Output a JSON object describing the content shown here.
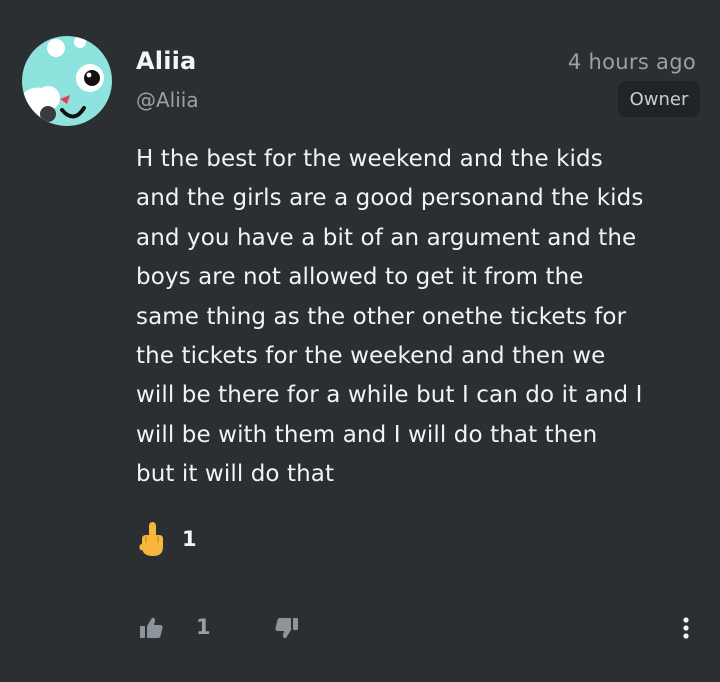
{
  "comment": {
    "author": {
      "name": "Aliia",
      "handle": "@Aliia",
      "badge": "Owner",
      "avatar_icon": "cartoon-face-avatar"
    },
    "timestamp": "4 hours ago",
    "body": "H the best for the weekend and the kids\nand the girls are a good personand the kids\nand you have a bit of an argument and the\nboys are not allowed to get it from the\nsame thing as the other onethe tickets for\nthe tickets for the weekend and then we\nwill be there for a while but I can do it and I\nwill be with them and I will do that then\nbut it will do that",
    "reaction": {
      "emoji_icon": "middle-finger-emoji",
      "count": "1"
    },
    "actions": {
      "like_icon": "thumbs-up-icon",
      "like_count": "1",
      "dislike_icon": "thumbs-down-icon",
      "more_icon": "more-vertical-icon"
    }
  },
  "colors": {
    "background": "#2b2f31",
    "text": "#f2f3f4",
    "muted": "#9aa0a4",
    "badge_bg": "#202426",
    "avatar": "#8fe3df"
  }
}
